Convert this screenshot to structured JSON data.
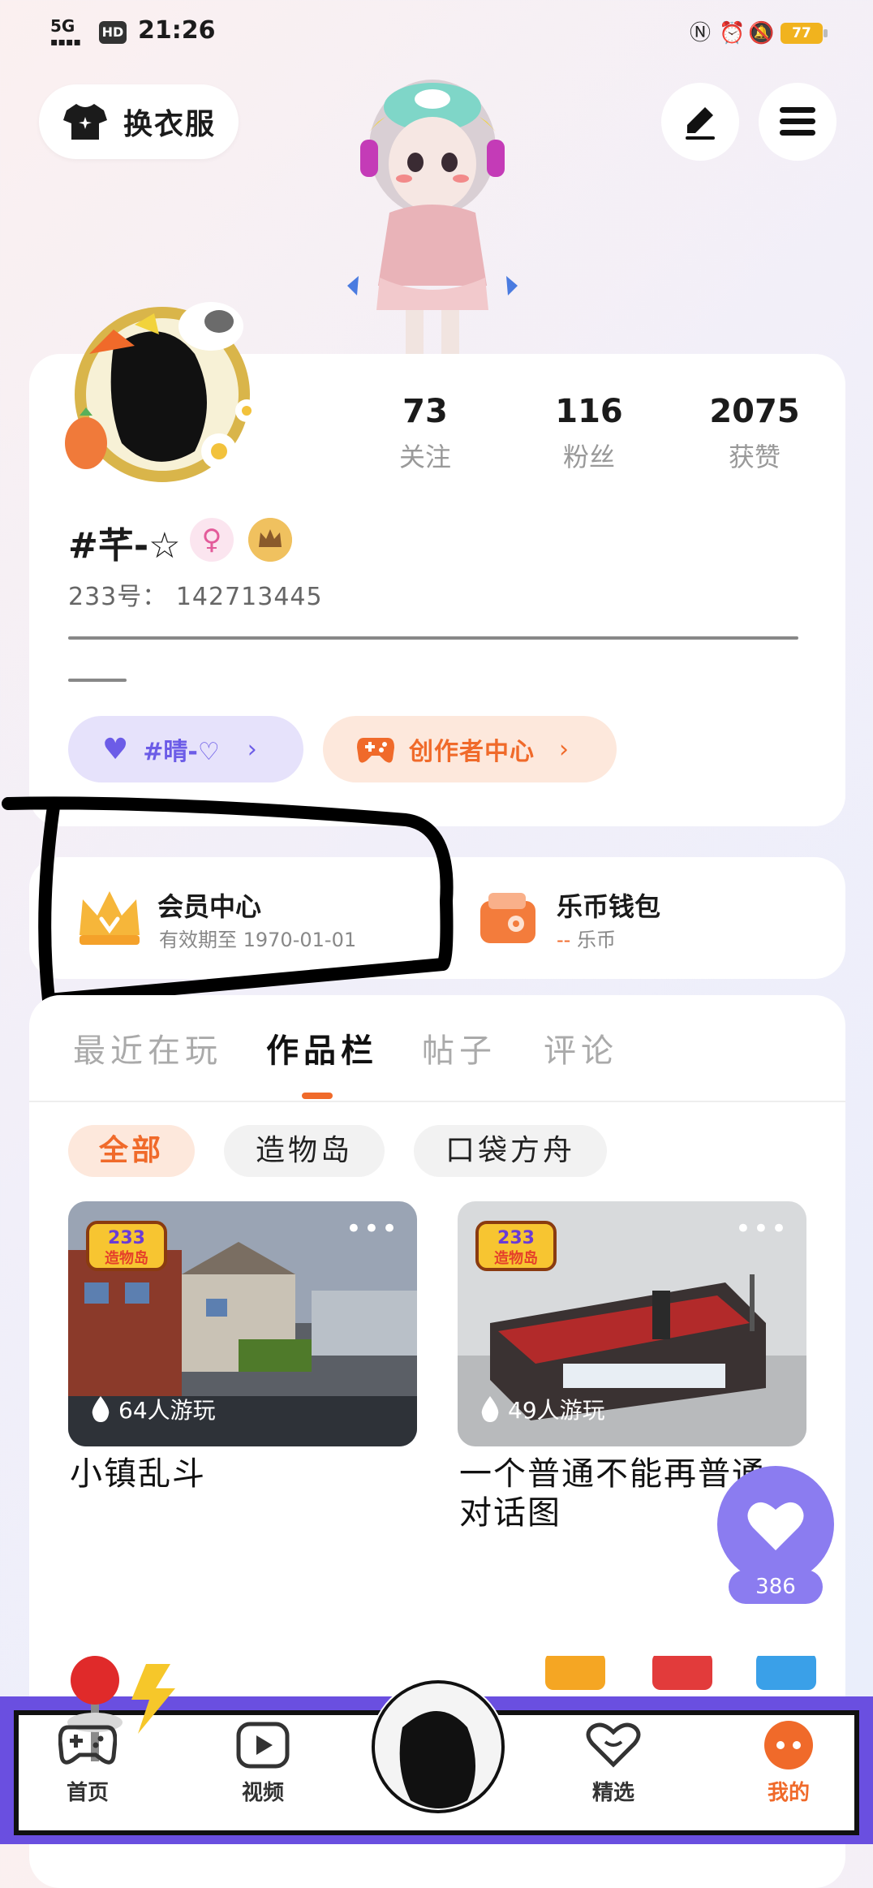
{
  "status_bar": {
    "network": "5G",
    "hd": "HD",
    "time": "21:26",
    "battery": "77"
  },
  "header": {
    "outfit_label": "换衣服",
    "edit_icon": "pen-icon",
    "menu_icon": "hamburger-icon"
  },
  "profile": {
    "stats": [
      {
        "value": "73",
        "label": "关注"
      },
      {
        "value": "116",
        "label": "粉丝"
      },
      {
        "value": "2075",
        "label": "获赞"
      }
    ],
    "username": "#芊-☆",
    "uid_label": "233号：",
    "uid": "142713445",
    "pill_friend_label": "#晴-♡",
    "pill_creator_label": "创作者中心"
  },
  "member": {
    "vip_title": "会员中心",
    "vip_subtitle": "有效期至 1970-01-01",
    "wallet_title": "乐币钱包",
    "wallet_amount": "--",
    "wallet_unit": "乐币"
  },
  "tabs": [
    "最近在玩",
    "作品栏",
    "帖子",
    "评论"
  ],
  "active_tab": "作品栏",
  "filters": [
    "全部",
    "造物岛",
    "口袋方舟"
  ],
  "works": [
    {
      "title": "小镇乱斗",
      "plays": "64人游玩",
      "logo": "233造物岛"
    },
    {
      "title": "一个普通不能再普通的对话图",
      "title_line1": "一个普通不能再普通",
      "title_line2": "对话图",
      "plays": "49人游玩",
      "logo": "233造物岛"
    }
  ],
  "like": {
    "count": "386"
  },
  "bottom_nav": [
    {
      "label": "首页",
      "icon": "gamepad-icon"
    },
    {
      "label": "视频",
      "icon": "play-icon"
    },
    {
      "label": "精选",
      "icon": "heart-icon"
    },
    {
      "label": "我的",
      "icon": "profile-icon"
    }
  ],
  "colors": {
    "accent_orange": "#f06a2a",
    "accent_purple": "#8b7cf0",
    "nav_purple": "#6a4fe0"
  }
}
